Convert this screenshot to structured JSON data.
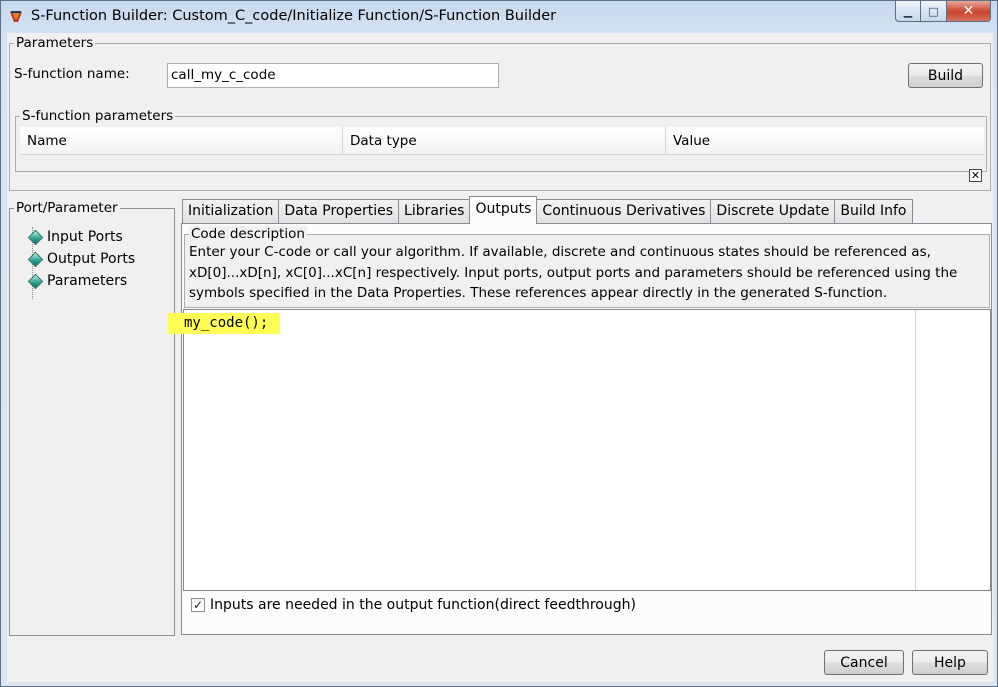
{
  "window": {
    "title": "S-Function Builder: Custom_C_code/Initialize Function/S-Function Builder",
    "controls": {
      "minimize": "▁",
      "maximize": "□",
      "close": "✕"
    }
  },
  "parameters": {
    "legend": "Parameters",
    "sfunction_name_label": "S-function name:",
    "sfunction_name_value": "call_my_c_code",
    "build_label": "Build",
    "sfunction_parameters": {
      "legend": "S-function parameters",
      "columns": [
        "Name",
        "Data type",
        "Value"
      ]
    },
    "close_mark": "✕"
  },
  "port_parameter": {
    "legend": "Port/Parameter",
    "items": [
      "Input Ports",
      "Output Ports",
      "Parameters"
    ]
  },
  "tabs": {
    "items": [
      "Initialization",
      "Data Properties",
      "Libraries",
      "Outputs",
      "Continuous Derivatives",
      "Discrete Update",
      "Build Info"
    ],
    "active": "Outputs"
  },
  "code_description": {
    "legend": "Code description",
    "lines": [
      "Enter your C-code or call your algorithm. If available, discrete and continuous states should be referenced as,",
      "xD[0]...xD[n], xC[0]...xC[n] respectively. Input ports, output ports and parameters should be referenced using the",
      "symbols specified in the Data Properties. These references appear directly in the generated S-function."
    ]
  },
  "code_editor": {
    "content": "my_code();"
  },
  "direct_feedthrough": {
    "label": "Inputs are needed in the output function(direct feedthrough)",
    "checked": true,
    "check_mark": "✓"
  },
  "footer": {
    "cancel_label": "Cancel",
    "help_label": "Help"
  },
  "colors": {
    "code_highlight": "#ffff55",
    "tree_icon": "#2a9d8f",
    "close_button": "#c9432b"
  },
  "icons": {
    "app": "simulink-icon",
    "tree_item": "diamond-icon"
  }
}
